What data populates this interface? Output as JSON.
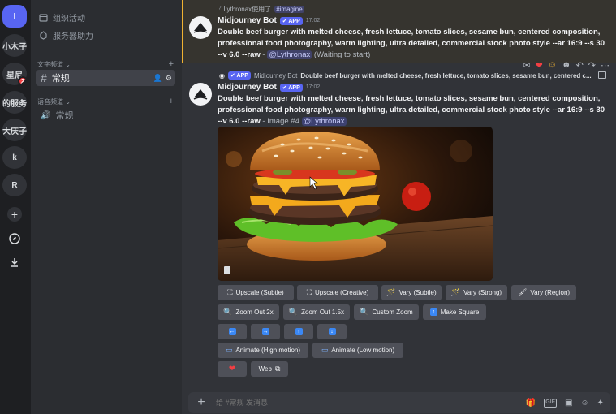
{
  "servers": {
    "top": "I",
    "items": [
      {
        "label": "小木子"
      },
      {
        "label": "星尼",
        "badge": "2"
      },
      {
        "label": "的服务"
      },
      {
        "label": "大庆子"
      },
      {
        "label": "k"
      },
      {
        "label": "R"
      }
    ],
    "icons": [
      "add-server-icon",
      "explore-icon",
      "download-icon"
    ]
  },
  "sidebar": {
    "events": "组织活动",
    "boost": "服务器助力",
    "text_category": "文字频道",
    "text_channel": "常规",
    "voice_category": "语音频道",
    "voice_channel": "常规"
  },
  "messages": {
    "first": {
      "reply_user": "Lythronax使用了",
      "reply_cmd": "imagine",
      "author": "Midjourney Bot",
      "tag": "APP",
      "time": "17:02",
      "prompt": "Double beef burger with melted cheese, fresh lettuce, tomato slices, sesame bun, centered composition, professional food photography, warm lighting, ultra detailed, commercial stock photo style --ar 16:9 --s 30 --v 6.0 --raw",
      "sep": " - ",
      "mention": "@Lythronax",
      "status": "(Waiting to start)"
    },
    "second": {
      "reply_tag": "APP",
      "reply_author": "Midjourney Bot",
      "reply_text": "Double beef burger with melted cheese, fresh lettuce, tomato slices, sesame bun, centered c...",
      "author": "Midjourney Bot",
      "tag": "APP",
      "time": "17:02",
      "prompt": "Double beef burger with melted cheese, fresh lettuce, tomato slices, sesame bun, centered composition, professional food photography, warm lighting, ultra detailed, commercial stock photo style --ar 16:9 --s 30 --v 6.0 --raw",
      "image_label": " - Image #4 ",
      "mention": "@Lythronax"
    }
  },
  "buttons": {
    "upscale_subtle": "Upscale (Subtle)",
    "upscale_creative": "Upscale (Creative)",
    "vary_subtle": "Vary (Subtle)",
    "vary_strong": "Vary (Strong)",
    "vary_region": "Vary (Region)",
    "zoom_2x": "Zoom Out 2x",
    "zoom_15x": "Zoom Out 1.5x",
    "custom_zoom": "Custom Zoom",
    "make_square": "Make Square",
    "animate_high": "Animate (High motion)",
    "animate_low": "Animate (Low motion)",
    "web": "Web"
  },
  "input": {
    "placeholder": "给 #常规 发消息"
  },
  "colors": {
    "accent": "#5865f2",
    "highlight_bar": "#f0b232",
    "button_bg": "#4e5058"
  }
}
